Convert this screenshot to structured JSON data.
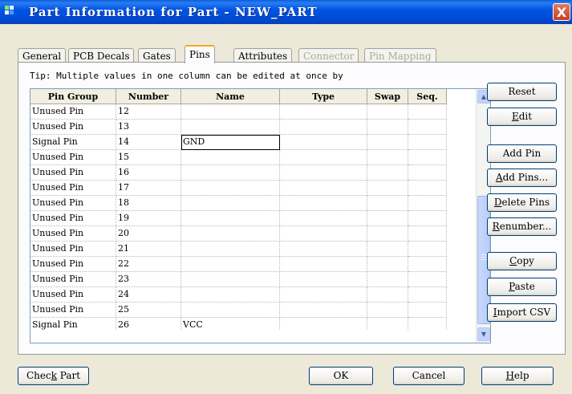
{
  "window": {
    "title": "Part Information for Part - NEW_PART",
    "close_label": "X"
  },
  "tabs": [
    {
      "label": "General",
      "state": "normal"
    },
    {
      "label": "PCB Decals",
      "state": "normal"
    },
    {
      "label": "Gates",
      "state": "normal"
    },
    {
      "label": "Pins",
      "state": "active"
    },
    {
      "label": "Attributes",
      "state": "normal"
    },
    {
      "label": "Connector",
      "state": "disabled"
    },
    {
      "label": "Pin Mapping",
      "state": "disabled"
    }
  ],
  "tip": "Tip: Multiple values in one column can be edited at once by",
  "grid": {
    "columns": [
      "Pin Group",
      "Number",
      "Name",
      "Type",
      "Swap",
      "Seq."
    ],
    "rows": [
      [
        "Unused Pin",
        "12",
        "",
        "",
        "",
        ""
      ],
      [
        "Unused Pin",
        "13",
        "",
        "",
        "",
        ""
      ],
      [
        "Signal Pin",
        "14",
        "GND",
        "",
        "",
        ""
      ],
      [
        "Unused Pin",
        "15",
        "",
        "",
        "",
        ""
      ],
      [
        "Unused Pin",
        "16",
        "",
        "",
        "",
        ""
      ],
      [
        "Unused Pin",
        "17",
        "",
        "",
        "",
        ""
      ],
      [
        "Unused Pin",
        "18",
        "",
        "",
        "",
        ""
      ],
      [
        "Unused Pin",
        "19",
        "",
        "",
        "",
        ""
      ],
      [
        "Unused Pin",
        "20",
        "",
        "",
        "",
        ""
      ],
      [
        "Unused Pin",
        "21",
        "",
        "",
        "",
        ""
      ],
      [
        "Unused Pin",
        "22",
        "",
        "",
        "",
        ""
      ],
      [
        "Unused Pin",
        "23",
        "",
        "",
        "",
        ""
      ],
      [
        "Unused Pin",
        "24",
        "",
        "",
        "",
        ""
      ],
      [
        "Unused Pin",
        "25",
        "",
        "",
        "",
        ""
      ],
      [
        "Signal Pin",
        "26",
        "VCC",
        "",
        "",
        ""
      ]
    ],
    "editing_cell": "GND"
  },
  "side_buttons": {
    "reset": "Reset",
    "edit": "Edit",
    "add_pin": "Add Pin",
    "add_pins": "Add Pins...",
    "delete_pins": "Delete Pins",
    "renumber": "Renumber...",
    "copy": "Copy",
    "paste": "Paste",
    "import_csv": "Import CSV"
  },
  "bottom_buttons": {
    "check_part": "Check Part",
    "ok": "OK",
    "cancel": "Cancel",
    "help": "Help"
  },
  "colors": {
    "titlebar": "#0055e5",
    "window_bg": "#ece9d8",
    "close": "#c8401f",
    "active_tab_accent": "#f5a623"
  }
}
